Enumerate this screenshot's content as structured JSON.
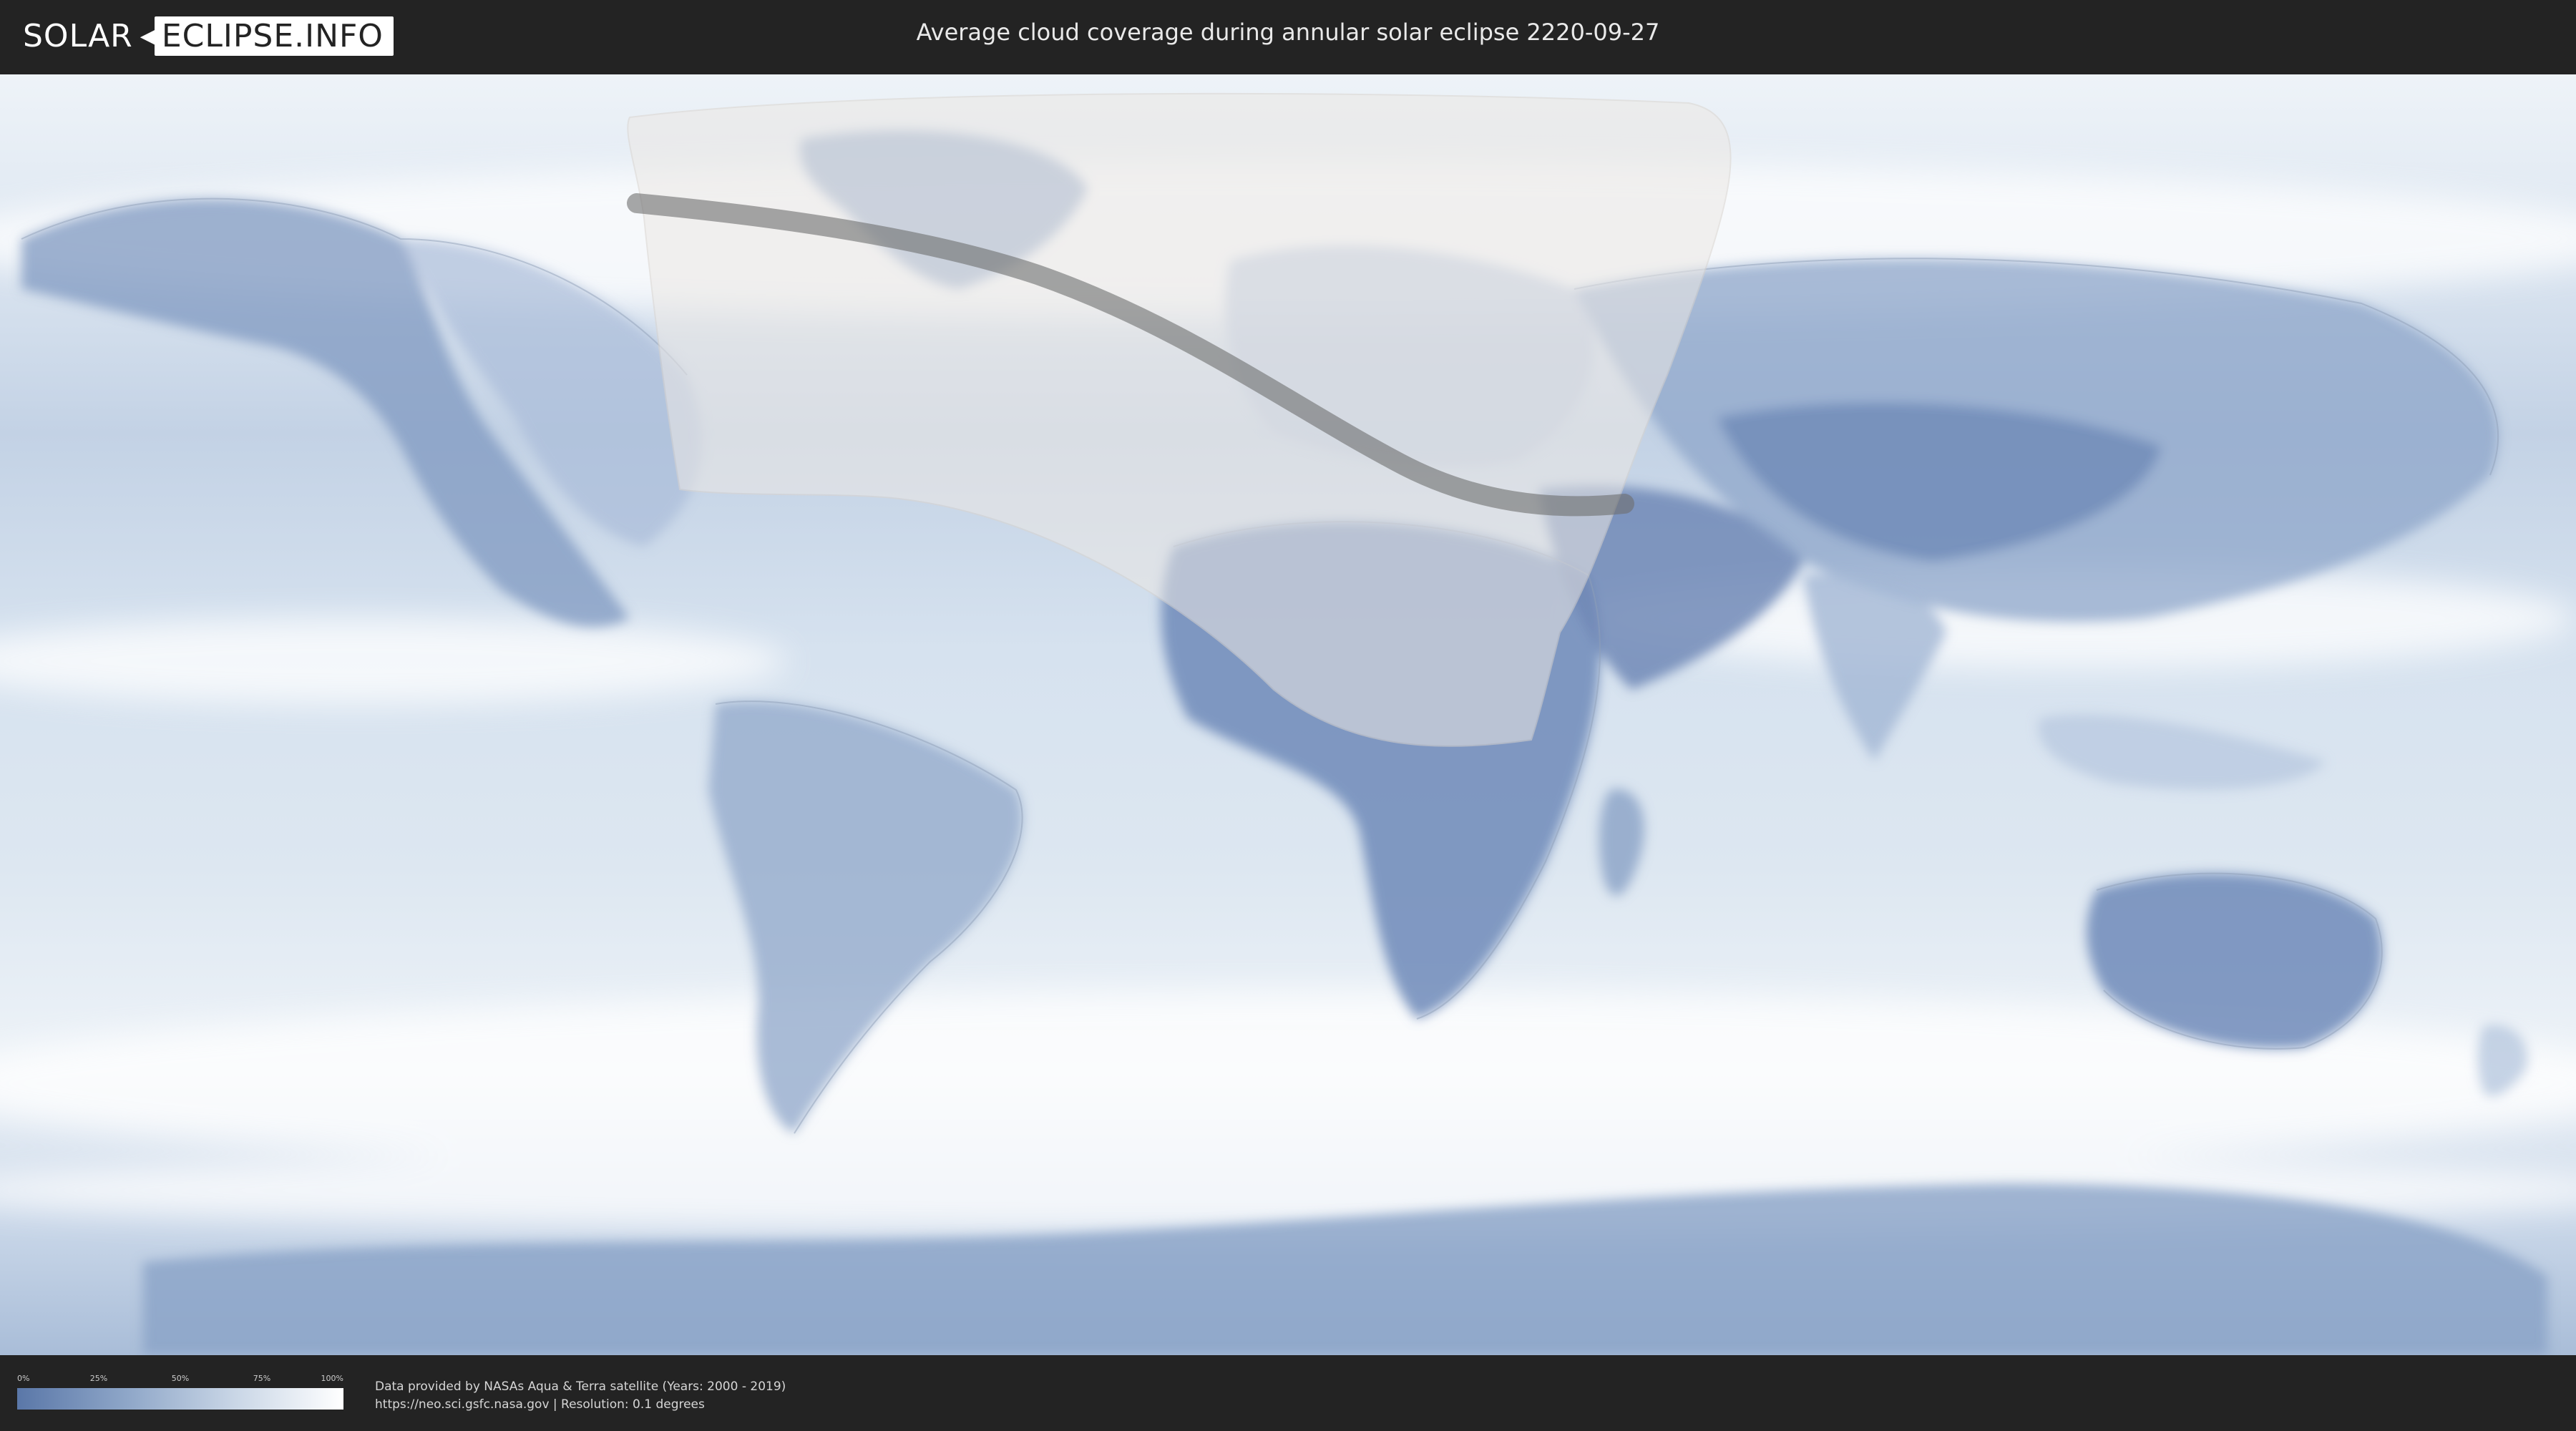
{
  "header": {
    "logo_part1": "SOLAR",
    "logo_part2": "ECLIPSE.INFO",
    "title": "Average cloud coverage during annular solar eclipse 2220-09-27"
  },
  "map": {
    "colors": {
      "ocean_base": "#cfdcea",
      "clear_sky": "#5a77a8",
      "full_cloud": "#ffffff",
      "eclipse_zone": "#e9e6e2",
      "central_line": "#6e6e6e"
    }
  },
  "legend": {
    "ticks": [
      "0%",
      "25%",
      "50%",
      "75%",
      "100%"
    ],
    "gradient_colors": [
      "#5a77a8",
      "#8ea6c8",
      "#c9d6e6",
      "#ffffff"
    ]
  },
  "credits": {
    "line1": "Data provided by NASAs Aqua & Terra satellite (Years: 2000 - 2019)",
    "line2": "https://neo.sci.gsfc.nasa.gov | Resolution: 0.1 degrees"
  }
}
